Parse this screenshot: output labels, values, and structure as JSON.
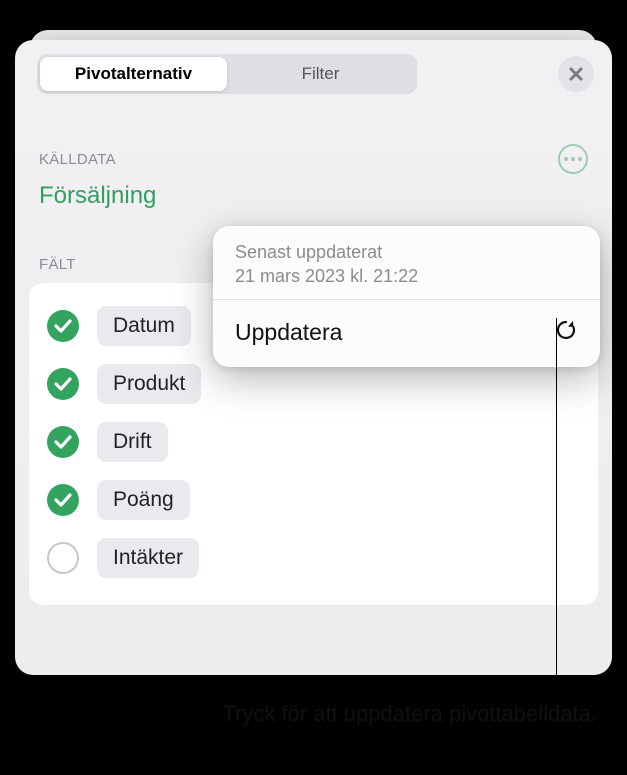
{
  "tabs": {
    "pivot_options": "Pivotalternativ",
    "filter": "Filter"
  },
  "source_data": {
    "section_label": "KÄLLDATA",
    "name": "Försäljning"
  },
  "fields": {
    "section_label": "FÄLT",
    "items": [
      {
        "label": "Datum",
        "checked": true
      },
      {
        "label": "Produkt",
        "checked": true
      },
      {
        "label": "Drift",
        "checked": true
      },
      {
        "label": "Poäng",
        "checked": true
      },
      {
        "label": "Intäkter",
        "checked": false
      }
    ]
  },
  "popover": {
    "last_updated_label": "Senast uppdaterat",
    "last_updated_value": "21 mars 2023 kl. 21:22",
    "refresh_label": "Uppdatera"
  },
  "callout": {
    "text": "Tryck för att uppdatera pivottabelldata."
  }
}
